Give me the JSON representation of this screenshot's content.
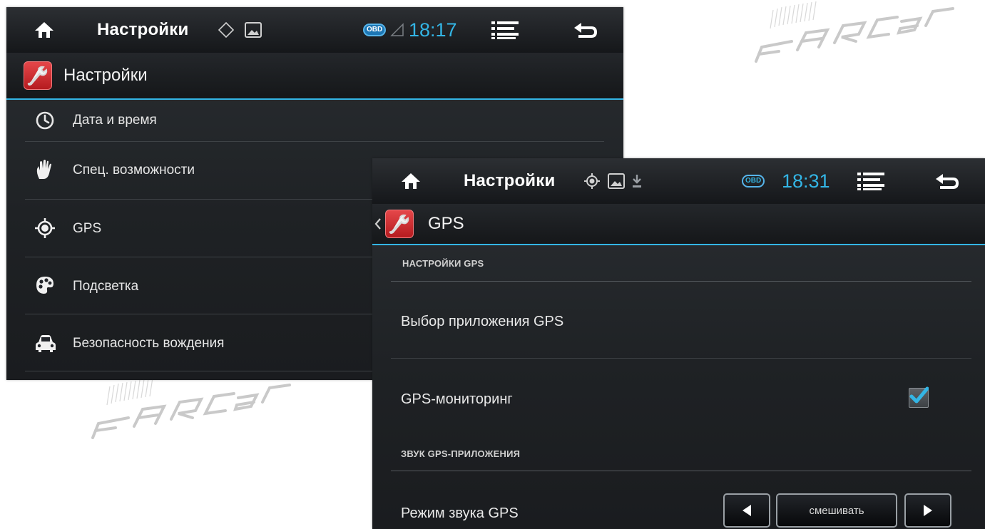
{
  "screen1": {
    "status_bar": {
      "title": "Настройки",
      "obd_badge": "OBD",
      "time": "18:17"
    },
    "action_bar": {
      "title": "Настройки"
    },
    "items": [
      {
        "label": "Дата и время",
        "icon": "clock-icon"
      },
      {
        "label": "Спец. возможности",
        "icon": "hand-icon"
      },
      {
        "label": "GPS",
        "icon": "gps-target-icon"
      },
      {
        "label": "Подсветка",
        "icon": "palette-icon"
      },
      {
        "label": "Безопасность вождения",
        "icon": "car-icon"
      }
    ]
  },
  "screen2": {
    "status_bar": {
      "title": "Настройки",
      "obd_badge": "OBD",
      "time": "18:31"
    },
    "action_bar": {
      "title": "GPS"
    },
    "sections": {
      "gps_settings": "НАСТРОЙКИ GPS",
      "gps_sound": "ЗВУК GPS-ПРИЛОЖЕНИЯ"
    },
    "settings": {
      "app_choice": "Выбор приложения GPS",
      "monitoring": "GPS-мониторинг",
      "monitoring_checked": true,
      "sound_mode": "Режим звука GPS",
      "sound_mode_value": "смешивать"
    }
  },
  "colors": {
    "accent": "#33b5e5",
    "obd_blue": "#1d77b5",
    "app_icon_red": "#d42f33",
    "watermark": "#c7c7c7"
  },
  "watermark": {
    "text": "FARCar"
  }
}
